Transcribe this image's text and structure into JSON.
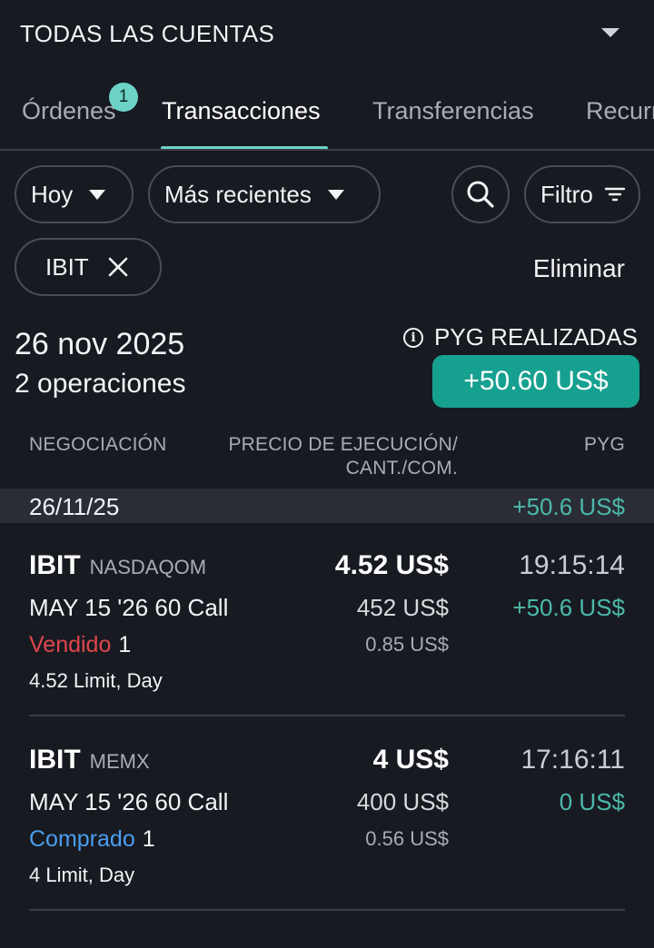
{
  "account": {
    "title": "TODAS LAS CUENTAS"
  },
  "tabs": [
    {
      "label": "Órdenes",
      "badge": "1"
    },
    {
      "label": "Transacciones"
    },
    {
      "label": "Transferencias"
    },
    {
      "label": "Recurr"
    }
  ],
  "filters": {
    "period": "Hoy",
    "sort": "Más recientes",
    "filter_label": "Filtro",
    "chip": "IBIT",
    "clear_label": "Eliminar"
  },
  "summary": {
    "date": "26 nov 2025",
    "operations": "2 operaciones",
    "pyg_label": "PYG REALIZADAS",
    "pyg_value": "+50.60 US$"
  },
  "columns": {
    "trade": "NEGOCIACIÓN",
    "price_line1": "PRECIO DE EJECUCIÓN/",
    "price_line2": "CANT./COM.",
    "pyg": "PYG"
  },
  "group": {
    "date": "26/11/25",
    "pyg": "+50.6 US$"
  },
  "rows": [
    {
      "symbol": "IBIT",
      "exchange": "NASDAQOM",
      "contract": "MAY 15 '26 60 Call",
      "side": "Vendido",
      "qty": "1",
      "order_type": "4.52 Limit, Day",
      "price": "4.52 US$",
      "total": "452 US$",
      "commission": "0.85 US$",
      "time": "19:15:14",
      "pyg": "+50.6 US$"
    },
    {
      "symbol": "IBIT",
      "exchange": "MEMX",
      "contract": "MAY 15 '26 60 Call",
      "side": "Comprado",
      "qty": "1",
      "order_type": "4 Limit, Day",
      "price": "4 US$",
      "total": "400 US$",
      "commission": "0.56 US$",
      "time": "17:16:11",
      "pyg": "0 US$"
    }
  ],
  "icons": [
    "chevron-down-icon",
    "search-icon",
    "filter-icon",
    "close-icon",
    "info-icon"
  ],
  "colors": {
    "accent": "#6dd3c8",
    "positive_badge": "#16a08f",
    "sold": "#e0474d",
    "bought": "#4a9ef0",
    "background": "#181a21"
  }
}
